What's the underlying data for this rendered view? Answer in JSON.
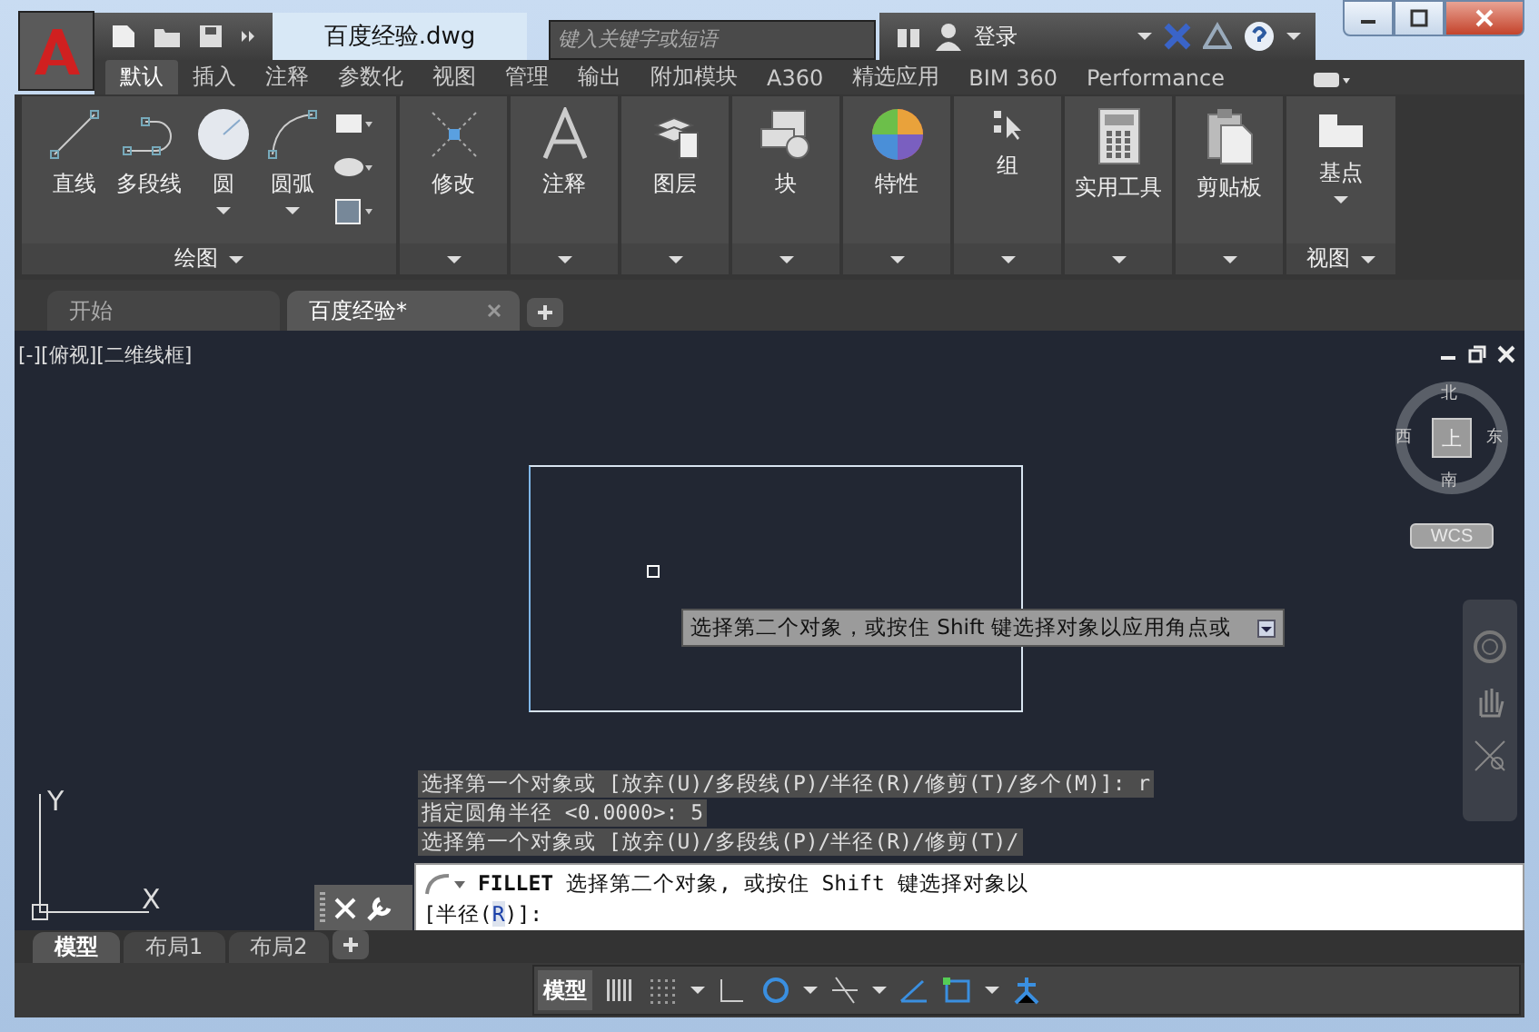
{
  "window": {
    "title": "百度经验.dwg"
  },
  "search": {
    "placeholder": "键入关键字或短语"
  },
  "account": {
    "label": "登录"
  },
  "ribbon_tabs": [
    {
      "label": "默认",
      "selected": true
    },
    {
      "label": "插入",
      "selected": false
    },
    {
      "label": "注释",
      "selected": false
    },
    {
      "label": "参数化",
      "selected": false
    },
    {
      "label": "视图",
      "selected": false
    },
    {
      "label": "管理",
      "selected": false
    },
    {
      "label": "输出",
      "selected": false
    },
    {
      "label": "附加模块",
      "selected": false
    },
    {
      "label": "A360",
      "selected": false
    },
    {
      "label": "精选应用",
      "selected": false
    },
    {
      "label": "BIM 360",
      "selected": false
    },
    {
      "label": "Performance",
      "selected": false
    }
  ],
  "draw_panel": {
    "title": "绘图",
    "tools": [
      {
        "label": "直线"
      },
      {
        "label": "多段线"
      },
      {
        "label": "圆"
      },
      {
        "label": "圆弧"
      }
    ]
  },
  "ribbon_panels": [
    {
      "label": "修改"
    },
    {
      "label": "注释"
    },
    {
      "label": "图层"
    },
    {
      "label": "块"
    },
    {
      "label": "特性"
    },
    {
      "label": "组"
    },
    {
      "label": "实用工具"
    },
    {
      "label": "剪贴板"
    }
  ],
  "view_panel": {
    "title": "视图",
    "tool": "基点"
  },
  "doc_tabs": [
    {
      "label": "开始",
      "selected": false
    },
    {
      "label": "百度经验*",
      "selected": true
    }
  ],
  "viewport": {
    "label": "[-][俯视][二维线框]"
  },
  "viewcube": {
    "north": "北",
    "south": "南",
    "east": "东",
    "west": "西",
    "face": "上",
    "wcs": "WCS"
  },
  "tooltip": "选择第二个对象，或按住 Shift 键选择对象以应用角点或",
  "command_history": [
    "选择第一个对象或 [放弃(U)/多段线(P)/半径(R)/修剪(T)/多个(M)]: r",
    "指定圆角半径 <0.0000>: 5",
    "选择第一个对象或 [放弃(U)/多段线(P)/半径(R)/修剪(T)/"
  ],
  "command_line": {
    "command": "FILLET",
    "prompt": "选择第二个对象, 或按住 Shift 键选择对象以",
    "input": {
      "before": "[半径(",
      "key": "R",
      "after": ")]:"
    }
  },
  "ucs": {
    "x": "X",
    "y": "Y"
  },
  "layout_tabs": [
    {
      "label": "模型",
      "selected": true
    },
    {
      "label": "布局1",
      "selected": false
    },
    {
      "label": "布局2",
      "selected": false
    }
  ],
  "status_bar": {
    "space": "模型"
  }
}
